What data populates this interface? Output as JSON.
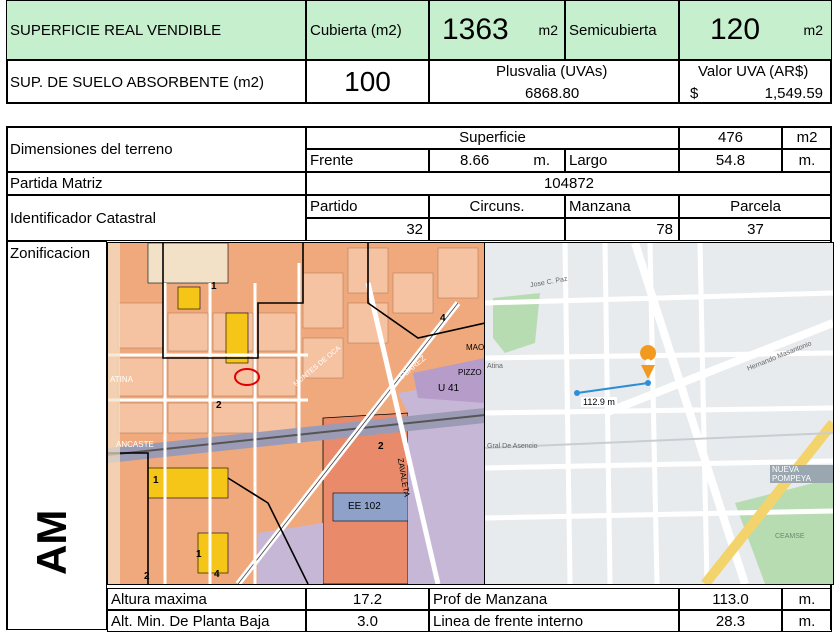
{
  "top": {
    "superficie_label": "SUPERFICIE REAL VENDIBLE",
    "cubierta_label": "Cubierta (m2)",
    "cubierta_value": "1363",
    "cubierta_unit": "m2",
    "semicubierta_label": "Semicubierta",
    "semicubierta_value": "120",
    "semicubierta_unit": "m2",
    "absorbente_label": "SUP. DE SUELO ABSORBENTE (m2)",
    "absorbente_value": "100",
    "plusvalia_label": "Plusvalia (UVAs)",
    "plusvalia_value": "6868.80",
    "valor_uva_label": "Valor UVA (AR$)",
    "valor_uva_currency": "$",
    "valor_uva_value": "1,549.59"
  },
  "terreno": {
    "dimensiones_label": "Dimensiones del terreno",
    "superficie_label": "Superficie",
    "superficie_value": "476",
    "superficie_unit": "m2",
    "frente_label": "Frente",
    "frente_value": "8.66",
    "frente_unit": "m.",
    "largo_label": "Largo",
    "largo_value": "54.8",
    "largo_unit": "m.",
    "partida_label": "Partida Matriz",
    "partida_value": "104872",
    "catastral_label": "Identificador Catastral",
    "partido_label": "Partido",
    "partido_value": "32",
    "circuns_label": "Circuns.",
    "circuns_value": "",
    "manzana_label": "Manzana",
    "manzana_value": "78",
    "parcela_label": "Parcela",
    "parcela_value": "37"
  },
  "zonificacion": {
    "label": "Zonificacion",
    "side_label": "AM",
    "zoning_map": {
      "zone_1a": "1",
      "zone_1b": "1",
      "zone_1c": "1",
      "zone_2a": "2",
      "zone_2b": "2",
      "zone_2c": "2",
      "zone_4a": "4",
      "zone_4b": "4",
      "zone_u41": "U 41",
      "zone_ee102": "EE 102",
      "street_ancaste": "ANCASTE",
      "street_atina": "ATINA",
      "street_zavaleta": "ZAVALETA",
      "street_suarez": "SUAREZ",
      "street_montes": "MONTES DE OCA",
      "street_pizzo": "PIZZO",
      "street_mao": "MAO"
    },
    "street_map": {
      "distance_label": "112.9 m",
      "street_1": "Jose C. Paz",
      "street_2": "Hernando Masantonio",
      "street_3": "Atina",
      "street_4": "Gral De Asencio",
      "street_5": "NUEVA POMPEYA",
      "street_6": "CEAMSE",
      "pin_color": "#f29a1f",
      "line_color": "#2c8fd6"
    }
  },
  "bottom": {
    "altura_label": "Altura maxima",
    "altura_value": "17.2",
    "prof_label": "Prof de Manzana",
    "prof_value": "113.0",
    "prof_unit": "m.",
    "alt_min_label": "Alt. Min. De Planta Baja",
    "alt_min_value": "3.0",
    "linea_label": "Linea de frente interno",
    "linea_value": "28.3",
    "linea_unit": "m."
  }
}
